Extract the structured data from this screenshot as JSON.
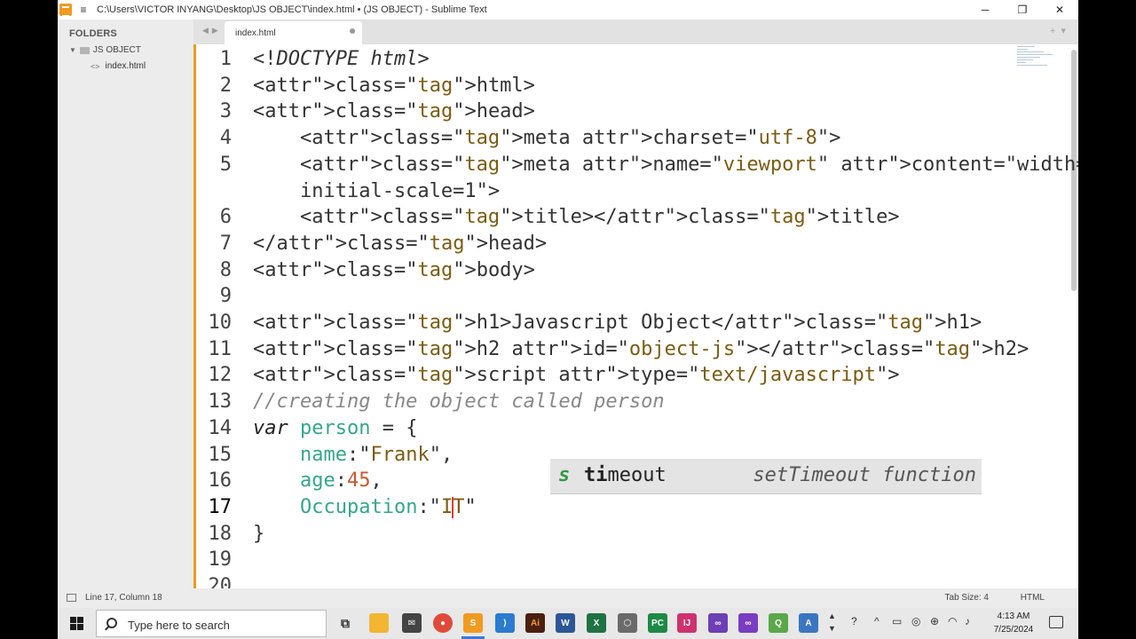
{
  "window": {
    "title": "C:\\Users\\VICTOR INYANG\\Desktop\\JS OBJECT\\index.html • (JS OBJECT) - Sublime Text",
    "minimize": "─",
    "maximize": "❐",
    "close": "✕"
  },
  "sidebar": {
    "heading": "FOLDERS",
    "folder": "JS OBJECT",
    "file": "index.html"
  },
  "tabs": [
    {
      "label": "index.html",
      "modified": true
    }
  ],
  "editor": {
    "current_line": 17,
    "lines": [
      {
        "n": "1",
        "code": "<!DOCTYPE html>"
      },
      {
        "n": "2",
        "code": "<html>"
      },
      {
        "n": "3",
        "code": "<head>"
      },
      {
        "n": "4",
        "code": "    <meta charset=\"utf-8\">"
      },
      {
        "n": "5",
        "code": "    <meta name=\"viewport\" content=\"width=device-width,"
      },
      {
        "n": "",
        "code": "    initial-scale=1\">"
      },
      {
        "n": "6",
        "code": "    <title></title>"
      },
      {
        "n": "7",
        "code": "</head>"
      },
      {
        "n": "8",
        "code": "<body>"
      },
      {
        "n": "9",
        "code": ""
      },
      {
        "n": "10",
        "code": "<h1>Javascript Object</h1>"
      },
      {
        "n": "11",
        "code": "<h2 id=\"object-js\"></h2>"
      },
      {
        "n": "12",
        "code": "<script type=\"text/javascript\">"
      },
      {
        "n": "13",
        "code": "//creating the object called person"
      },
      {
        "n": "14",
        "code": "var person = {"
      },
      {
        "n": "15",
        "code": "    name:\"Frank\","
      },
      {
        "n": "16",
        "code": "    age:45,"
      },
      {
        "n": "17",
        "code": "    Occupation:\"IT\""
      },
      {
        "n": "18",
        "code": "}"
      },
      {
        "n": "19",
        "code": ""
      },
      {
        "n": "20",
        "code": ""
      }
    ]
  },
  "autocomplete": {
    "kind": "s",
    "trigger_match": "ti",
    "trigger_rest": "meout",
    "description": "setTimeout function"
  },
  "statusbar": {
    "position": "Line 17, Column 18",
    "tab_size": "Tab Size: 4",
    "syntax": "HTML"
  },
  "taskbar": {
    "search_placeholder": "Type here to search",
    "time": "4:13 AM",
    "date": "7/25/2024"
  }
}
